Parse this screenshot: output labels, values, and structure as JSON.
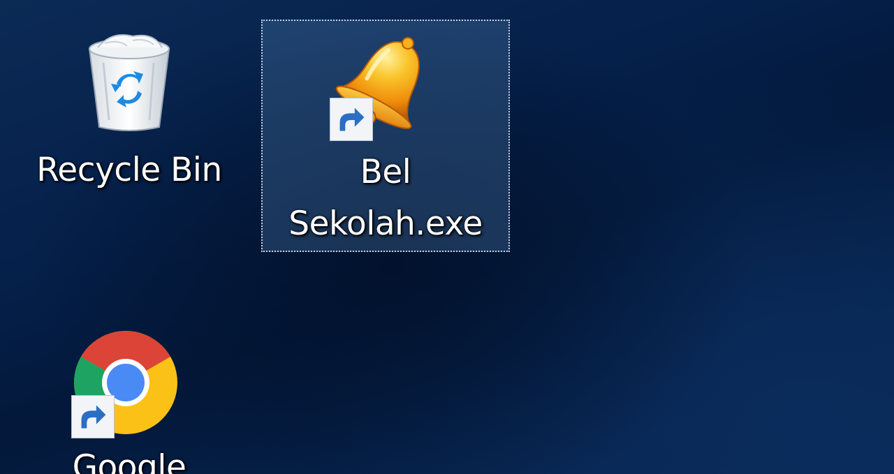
{
  "desktop": {
    "icons": [
      {
        "label": "Recycle Bin",
        "icon": "recycle-bin-icon",
        "selected": false,
        "shortcut": false
      },
      {
        "label": "Bel Sekolah.exe",
        "label_lines": [
          "Bel",
          "Sekolah.exe"
        ],
        "icon": "bell-icon",
        "selected": true,
        "shortcut": true
      },
      {
        "label": "Google",
        "icon": "chrome-icon",
        "selected": false,
        "shortcut": true
      }
    ]
  },
  "colors": {
    "wallpaper": "#05204a",
    "selection_fill": "#3a6490",
    "label_text": "#ffffff",
    "bell_gold": "#f6b21a"
  }
}
